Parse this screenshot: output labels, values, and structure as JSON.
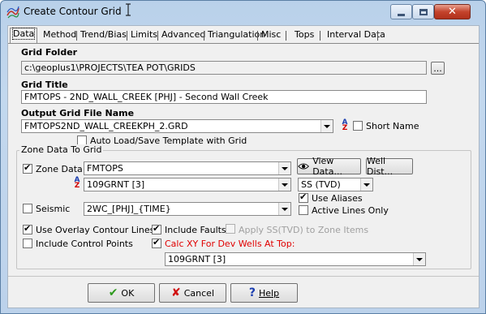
{
  "window": {
    "title": "Create Contour Grid"
  },
  "tabs": [
    {
      "label": "Data"
    },
    {
      "label": "Method"
    },
    {
      "label": "Trend/Bias"
    },
    {
      "label": "Limits"
    },
    {
      "label": "Advanced"
    },
    {
      "label": "Triangulation"
    },
    {
      "label": "Misc"
    },
    {
      "label": "Tops"
    },
    {
      "label": "Interval Data"
    }
  ],
  "grid_folder": {
    "label": "Grid Folder",
    "value": "c:\\geoplus1\\PROJECTS\\TEA POT\\GRIDS",
    "browse_label": "..."
  },
  "grid_title": {
    "label": "Grid Title",
    "value": "FMTOPS - 2ND_WALL_CREEK [PHJ] - Second Wall Creek"
  },
  "output_grid": {
    "label": "Output Grid File Name",
    "value": "FMTOPS2ND_WALL_CREEKPH_2.GRD",
    "short_name_label": "Short Name",
    "short_name_checked": false,
    "auto_load_label": "Auto Load/Save Template with Grid",
    "auto_load_checked": false
  },
  "zone_data": {
    "group_label": "Zone Data To Grid",
    "zone_data_label": "Zone Data",
    "zone_data_checked": true,
    "zone_data_value": "FMTOPS",
    "horizon_value": "109GRNT  [3]",
    "view_data_label": "View Data...",
    "well_dist_label": "Well Dist...",
    "ss_value": "SS (TVD)",
    "use_aliases_label": "Use Aliases",
    "use_aliases_checked": true,
    "active_lines_label": "Active Lines Only",
    "active_lines_checked": false,
    "seismic_label": "Seismic",
    "seismic_checked": false,
    "seismic_value": "2WC_[PHJ]_{TIME}",
    "overlay_label": "Use Overlay Contour Lines",
    "overlay_checked": true,
    "control_points_label": "Include Control Points",
    "control_points_checked": false,
    "include_faults_label": "Include Faults",
    "include_faults_checked": true,
    "apply_ss_label": "Apply SS(TVD) to Zone Items",
    "apply_ss_checked": false,
    "calc_xy_label": "Calc XY For Dev Wells At Top:",
    "calc_xy_checked": true,
    "calc_xy_value": "109GRNT  [3]"
  },
  "buttons": {
    "ok": "OK",
    "cancel": "Cancel",
    "help": "Help"
  },
  "colors": {
    "accent_red": "#e00000",
    "ok_green": "#2e9a1e",
    "cancel_red": "#d01010",
    "help_blue": "#1c3fb0"
  }
}
